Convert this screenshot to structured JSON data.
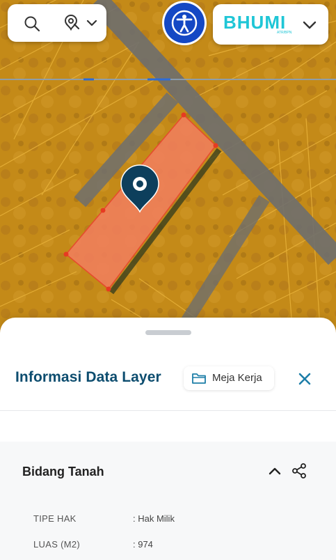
{
  "map": {
    "parcel_color": "#f07e5c",
    "marker_color": "#0d3f5c",
    "road_color": "#6c6c6c",
    "brand_logo_text": "BHUMI",
    "brand_logo_subtext": "ATR/BPN",
    "brand_color": "#1fc6d6",
    "search_icon": "search-icon",
    "location_search_icon": "location-search-icon",
    "accessibility_icon": "accessibility-icon"
  },
  "sheet": {
    "title": "Informasi Data Layer",
    "meja_kerja_label": "Meja Kerja",
    "section_title": "Bidang Tanah",
    "rows": [
      {
        "label": "TIPE HAK",
        "value": ": Hak Milik"
      },
      {
        "label": "LUAS (M2)",
        "value": ": 974"
      }
    ]
  }
}
